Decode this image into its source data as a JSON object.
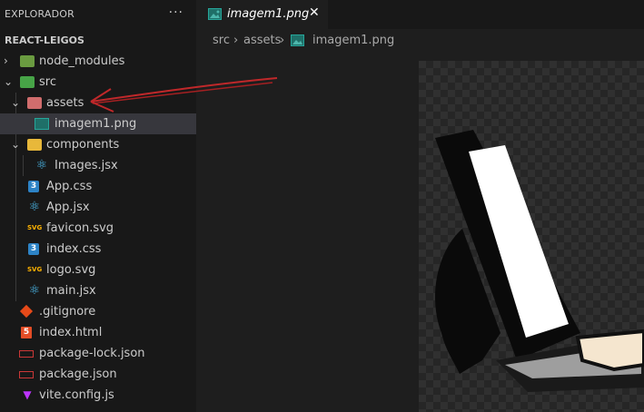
{
  "sidebar": {
    "title": "EXPLORADOR",
    "more": "···",
    "project": "REACT-LEIGOS",
    "items": [
      {
        "label": "node_modules",
        "icon": "folder-node-icon",
        "chevron": "›"
      },
      {
        "label": "src",
        "icon": "folder-src-icon",
        "chevron": "⌄"
      },
      {
        "label": "assets",
        "icon": "folder-assets-icon",
        "chevron": "⌄"
      },
      {
        "label": "imagem1.png",
        "icon": "image-file-icon"
      },
      {
        "label": "components",
        "icon": "folder-components-icon",
        "chevron": "⌄"
      },
      {
        "label": "Images.jsx",
        "icon": "react-icon"
      },
      {
        "label": "App.css",
        "icon": "css-icon",
        "glyph": "3"
      },
      {
        "label": "App.jsx",
        "icon": "react-icon"
      },
      {
        "label": "favicon.svg",
        "icon": "svg-icon",
        "glyph": "SVG"
      },
      {
        "label": "index.css",
        "icon": "css-icon",
        "glyph": "3"
      },
      {
        "label": "logo.svg",
        "icon": "svg-icon",
        "glyph": "SVG"
      },
      {
        "label": "main.jsx",
        "icon": "react-icon"
      },
      {
        "label": ".gitignore",
        "icon": "git-icon"
      },
      {
        "label": "index.html",
        "icon": "html-icon",
        "glyph": "5"
      },
      {
        "label": "package-lock.json",
        "icon": "npm-icon",
        "glyph": "npm"
      },
      {
        "label": "package.json",
        "icon": "npm-icon",
        "glyph": "npm"
      },
      {
        "label": "vite.config.js",
        "icon": "vite-icon",
        "glyph": "▼"
      }
    ]
  },
  "tab": {
    "label": "imagem1.png",
    "close": "✕"
  },
  "breadcrumb": {
    "parts": [
      "src",
      "assets",
      "imagem1.png"
    ],
    "separator": "›"
  },
  "colors": {
    "annotation_arrow": "#c0282a",
    "selected_row": "#37373d",
    "sidebar_bg": "#181818",
    "editor_bg": "#1e1e1e"
  }
}
